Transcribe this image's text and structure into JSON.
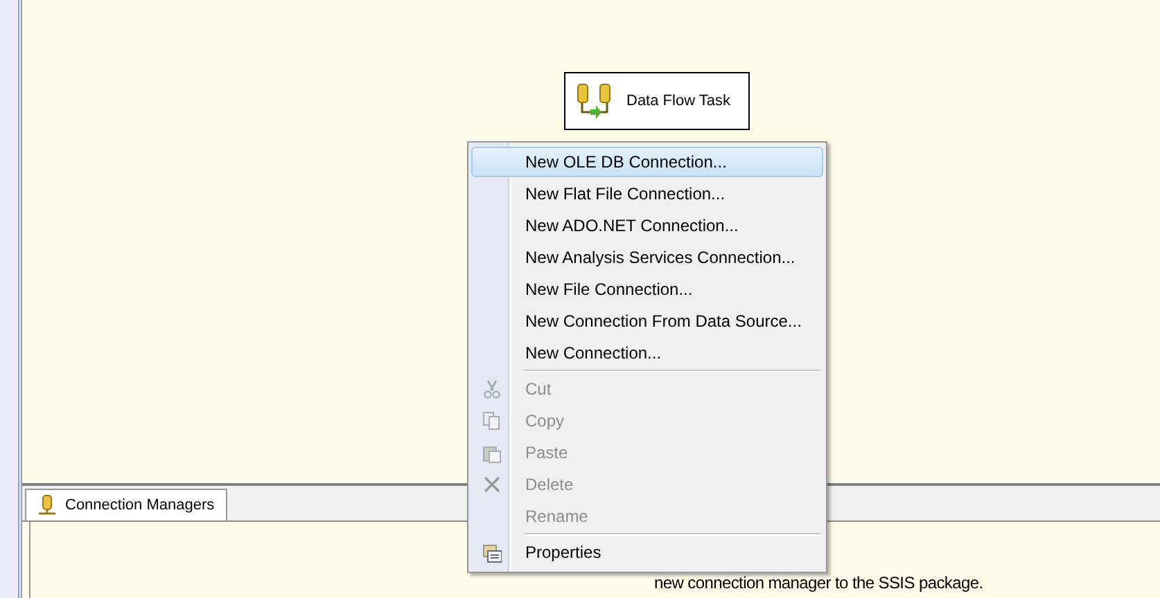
{
  "canvas": {
    "task": {
      "label": "Data Flow Task"
    }
  },
  "bottom_panel": {
    "tabs": [
      {
        "label": "Connection Managers",
        "selected": true
      }
    ],
    "hint": "new connection manager to the SSIS package."
  },
  "context_menu": {
    "items": [
      {
        "kind": "item",
        "label": "New OLE DB Connection...",
        "selected": true,
        "disabled": false
      },
      {
        "kind": "item",
        "label": "New Flat File Connection...",
        "selected": false,
        "disabled": false
      },
      {
        "kind": "item",
        "label": "New ADO.NET Connection...",
        "selected": false,
        "disabled": false
      },
      {
        "kind": "item",
        "label": "New Analysis Services Connection...",
        "selected": false,
        "disabled": false
      },
      {
        "kind": "item",
        "label": "New File Connection...",
        "selected": false,
        "disabled": false
      },
      {
        "kind": "item",
        "label": "New Connection From Data Source...",
        "selected": false,
        "disabled": false
      },
      {
        "kind": "item",
        "label": "New Connection...",
        "selected": false,
        "disabled": false
      },
      {
        "kind": "separator"
      },
      {
        "kind": "item",
        "label": "Cut",
        "selected": false,
        "disabled": true
      },
      {
        "kind": "item",
        "label": "Copy",
        "selected": false,
        "disabled": true
      },
      {
        "kind": "item",
        "label": "Paste",
        "selected": false,
        "disabled": true
      },
      {
        "kind": "item",
        "label": "Delete",
        "selected": false,
        "disabled": true
      },
      {
        "kind": "item",
        "label": "Rename",
        "selected": false,
        "disabled": true
      },
      {
        "kind": "separator"
      },
      {
        "kind": "item",
        "label": "Properties",
        "selected": false,
        "disabled": false
      }
    ]
  }
}
